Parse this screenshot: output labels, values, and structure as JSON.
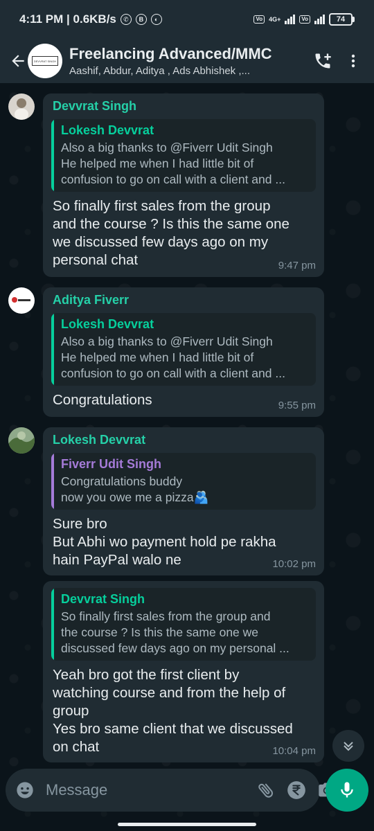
{
  "status_bar": {
    "time_speed": "4:11 PM | 0.6KB/s",
    "network_label": "4G+",
    "battery": "74"
  },
  "header": {
    "group_name": "Freelancing Advanced/MMC",
    "members": "Aashif, Abdur, Aditya , Ads Abhishek ,...",
    "avatar_text": "DEVVRAT SINGH"
  },
  "messages": [
    {
      "sender": "Devvrat Singh",
      "sender_color": "#25d0a8",
      "quote_author": "Lokesh Devvrat",
      "quote_color": "#06cf9c",
      "quote_text": "Also a big thanks to @Fiverr Udit Singh\nHe helped me when I had little bit of\nconfusion to go on call with a client and ...",
      "text": "So finally first sales from the group\nand the course ? Is this the same one\nwe discussed few days ago on my\npersonal chat",
      "time": "9:47 pm"
    },
    {
      "sender": "Aditya Fiverr",
      "sender_color": "#25d0a8",
      "quote_author": "Lokesh Devvrat",
      "quote_color": "#06cf9c",
      "quote_text": "Also a big thanks to @Fiverr Udit Singh\nHe helped me when I had little bit of\nconfusion to go on call with a client and ...",
      "text": "Congratulations",
      "time": "9:55 pm"
    },
    {
      "sender": "Lokesh Devvrat",
      "sender_color": "#25d0a8",
      "quote_author": "Fiverr Udit Singh",
      "quote_color": "#a57bd8",
      "quote_text": "Congratulations buddy\nnow you owe me a pizza🫂",
      "text": "Sure bro\nBut Abhi wo payment hold pe rakha\nhain PayPal walo ne",
      "time": "10:02 pm"
    },
    {
      "quote_author": "Devvrat Singh",
      "quote_color": "#06cf9c",
      "quote_text": "So finally first sales from the group and\nthe course ? Is this the same one we\ndiscussed few days ago on my personal ...",
      "text": "Yeah bro got the first client by\nwatching course and from the help of\ngroup\nYes bro same client that we discussed\non chat",
      "time": "10:04 pm"
    }
  ],
  "input": {
    "placeholder": "Message"
  },
  "colors": {
    "accent": "#00a884",
    "bubble": "#202c33",
    "background": "#0b141a"
  }
}
